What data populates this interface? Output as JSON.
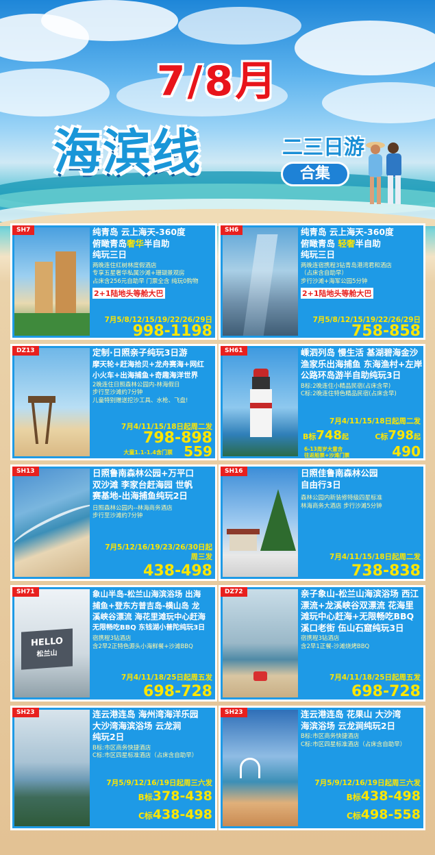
{
  "header": {
    "month": "7/8月",
    "title": "海滨线",
    "sub": "二三日游",
    "pill": "合集"
  },
  "cards": [
    {
      "code": "SH7",
      "t": [
        "纯青岛 云上海天-360度",
        "俯瞰青岛",
        "奢华",
        "半自助",
        "纯玩三日"
      ],
      "d": [
        "两晚连住红树林度假酒店",
        "专享五星奢华私属沙滩+珊瑚景观房",
        "占床含256元自助早 门票全含 纯玩0购物"
      ],
      "bus": "2+1陆地头等舱大巴",
      "date": "7月5/8/12/15/19/22/26/29日",
      "price": "998-1198"
    },
    {
      "code": "SH6",
      "t": [
        "纯青岛 云上海天-360度",
        "俯瞰青岛 ",
        "轻奢",
        "半自助",
        "纯玩三日"
      ],
      "d": [
        "两晚连宿携程3钻青岛港湾君和酒店",
        "（占床含自助早）",
        "步行沙滩+海军公园5分钟"
      ],
      "bus": "2+1陆地头等舱大巴",
      "date": "7月5/8/12/15/19/22/26/29日",
      "price": "758-858"
    },
    {
      "code": "DZ13",
      "t": [
        "定制·日照亲子纯玩3日游",
        "摩天轮+赶海拾贝+龙舟赛海+网红",
        "小火车+出海捕鱼+奇趣海洋世界"
      ],
      "d": [
        "2晚连住日照森林公园内-林海假日",
        "步行至沙滩约7分钟",
        "儿童特别赠送挖沙工具、水枪、飞盘!"
      ],
      "date": "7月4/11/15/18日起周二发",
      "price": "798-898",
      "extra_label": "大童1.1-1.4含门票",
      "extra_price": "559"
    },
    {
      "code": "SH61",
      "t": [
        "嵊泗列岛 慢生活 基湖碧海金沙",
        "渔家乐出海捕鱼 东海渔村+左岸",
        "公路环岛游半自助纯玩3日"
      ],
      "d": [
        "B标:2晚连住小精品民宿(占床含早)",
        "C标:2晚连住特色精品民宿(占床含早)"
      ],
      "date": "7月4/11/15/18日起周二发",
      "b_label": "B标",
      "b_price": "748",
      "b_suffix": "起",
      "c_label": "C标",
      "c_price": "798",
      "c_suffix": "起",
      "extra_label1": "6-13周岁大童含",
      "extra_label2": "往返船票+沙滩门票",
      "extra_price": "490"
    },
    {
      "code": "SH13",
      "t": [
        "日照鲁南森林公园+万平口",
        "双沙滩 李家台赶海园 世帆",
        "赛基地-出海捕鱼纯玩2日"
      ],
      "d": [
        "日照森林公园内--林海商务酒店",
        "步行至沙滩约7分钟"
      ],
      "date": "7月5/12/16/19/23/26/30日起",
      "date2": "周三发",
      "price": "438-498"
    },
    {
      "code": "SH16",
      "t": [
        "日照佳鲁南森林公园",
        "自由行3日"
      ],
      "d": [
        "森林公园内新装修特级四星标准",
        "林海商务大酒店 步行沙滩5分钟"
      ],
      "date": "7月4/11/15/18日起周二发",
      "price": "738-838"
    },
    {
      "code": "SH71",
      "t": [
        "象山半岛-松兰山海滨浴场 出海",
        "捕鱼+登东方普吉岛-横山岛 龙",
        "溪峡谷漂流 海花里滩玩中心赶海",
        "无限畅吃BBQ 东钱湖小普陀纯玩3日"
      ],
      "d": [
        "宿携程3钻酒店",
        "含2早2正特色源头小海鲜餐+沙滩BBQ"
      ],
      "date": "7月4/11/18/25日起周五发",
      "price": "698-728",
      "photo_sign": "HELLO",
      "photo_sign2": "松兰山"
    },
    {
      "code": "DZ72",
      "t": [
        "亲子象山-松兰山海滨浴场 西江",
        "漂流+龙溪峡谷双漂流 花海里",
        "滩玩中心赶海+无限畅吃BBQ",
        "溪口老街 伍山石窟纯玩3日"
      ],
      "d": [
        "宿携程3钻酒店",
        "含2早1正餐-沙滩烧烤BBQ"
      ],
      "date": "7月4/11/18/25日起周五发",
      "price": "698-728"
    },
    {
      "code": "SH23",
      "t": [
        "连云港连岛 海州湾海洋乐园",
        "大沙湾海滨浴场 云龙涧",
        "纯玩2日"
      ],
      "d": [
        "B标:市区商务快捷酒店",
        "C标:市区四星标准酒店（占床含自助早）"
      ],
      "date": "7月5/9/12/16/19日起周三六发",
      "b_label": "B标",
      "b_price": "378-438",
      "c_label": "C标",
      "c_price": "438-498"
    },
    {
      "code": "SH23",
      "t": [
        "连云港连岛 花果山 大沙湾",
        "海滨浴场 云龙涧纯玩2日"
      ],
      "d": [
        "B标:市区商务快捷酒店",
        "C标:市区四星标准酒店（占床含自助早）"
      ],
      "date": "7月5/9/12/16/19日起周三六发",
      "b_label": "B标",
      "b_price": "438-498",
      "c_label": "C标",
      "c_price": "498-558"
    }
  ],
  "colors": {
    "card_bg": "#1e9ae6",
    "price": "#ffe600",
    "code_bg": "#e8201e",
    "title_red": "#e8141b"
  }
}
